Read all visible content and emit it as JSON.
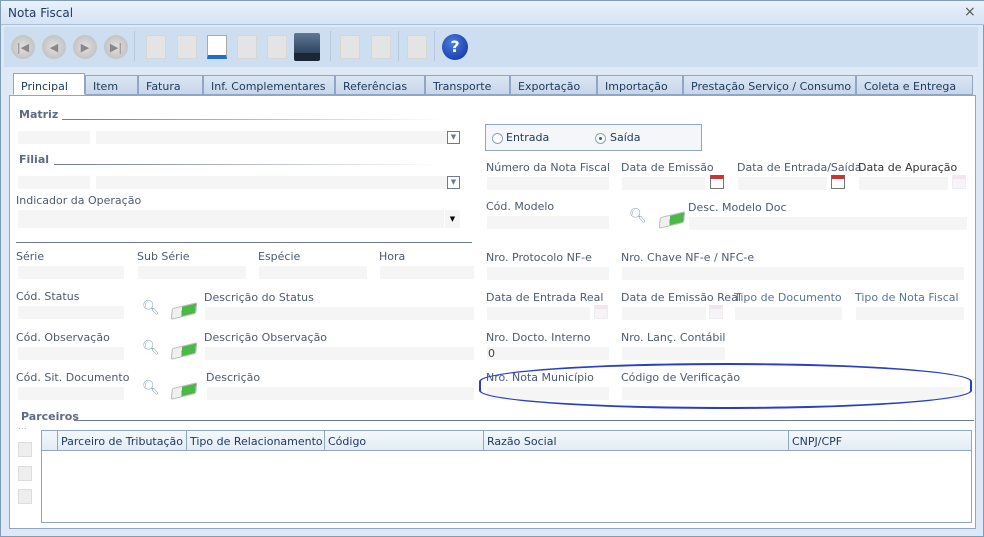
{
  "window": {
    "title": "Nota Fiscal",
    "close": "×"
  },
  "toolbar": {
    "first": "|◀",
    "prev": "◀",
    "next": "▶",
    "last": "▶|",
    "help": "?",
    "icons": [
      "first-record-icon",
      "previous-record-icon",
      "next-record-icon",
      "last-record-icon",
      "new-document-icon",
      "edit-icon",
      "undo-icon",
      "cancel-icon",
      "redo-icon",
      "save-icon",
      "report-icon",
      "totals-icon",
      "lock-icon",
      "help-icon"
    ]
  },
  "tabs": [
    "Principal",
    "Item",
    "Fatura",
    "Inf. Complementares",
    "Referências",
    "Transporte",
    "Exportação",
    "Importação",
    "Prestação Serviço / Consumo",
    "Coleta e Entrega"
  ],
  "sections": {
    "matriz": "Matriz",
    "filial": "Filial",
    "parceiros": "Parceiros"
  },
  "labels": {
    "indicador": "Indicador da Operação",
    "numero_nf": "Número da Nota Fiscal",
    "data_emissao": "Data de Emissão",
    "data_entrada_saida": "Data de Entrada/Saída",
    "data_apuracao": "Data de Apuração",
    "cod_modelo": "Cód. Modelo",
    "desc_modelo": "Desc. Modelo Doc",
    "serie": "Série",
    "sub_serie": "Sub Série",
    "especie": "Espécie",
    "hora": "Hora",
    "protocolo": "Nro. Protocolo NF-e",
    "chave": "Nro. Chave NF-e / NFC-e",
    "cod_status": "Cód. Status",
    "desc_status": "Descrição do Status",
    "data_entrada_real": "Data de Entrada Real",
    "data_emissao_real": "Data de Emissão Real",
    "tipo_documento": "Tipo de Documento",
    "tipo_nota": "Tipo de Nota Fiscal",
    "cod_obs": "Cód. Observação",
    "desc_obs": "Descrição Observação",
    "docto_interno": "Nro. Docto. Interno",
    "lanc_contabil": "Nro. Lanç. Contábil",
    "cod_sit": "Cód. Sit. Documento",
    "descricao": "Descrição",
    "nota_municipio": "Nro. Nota Município",
    "cod_verificacao": "Código de Verificação"
  },
  "radio": {
    "entrada": "Entrada",
    "saida": "Saída",
    "selected": "Saída"
  },
  "values": {
    "docto_interno": "0"
  },
  "grid": {
    "columns": [
      "Parceiro de Tributação",
      "Tipo de Relacionamento",
      "Código",
      "Razão Social",
      "CNPJ/CPF"
    ],
    "side_dots": "..."
  },
  "colors": {
    "highlight_ellipse": "#2b3fc4"
  }
}
